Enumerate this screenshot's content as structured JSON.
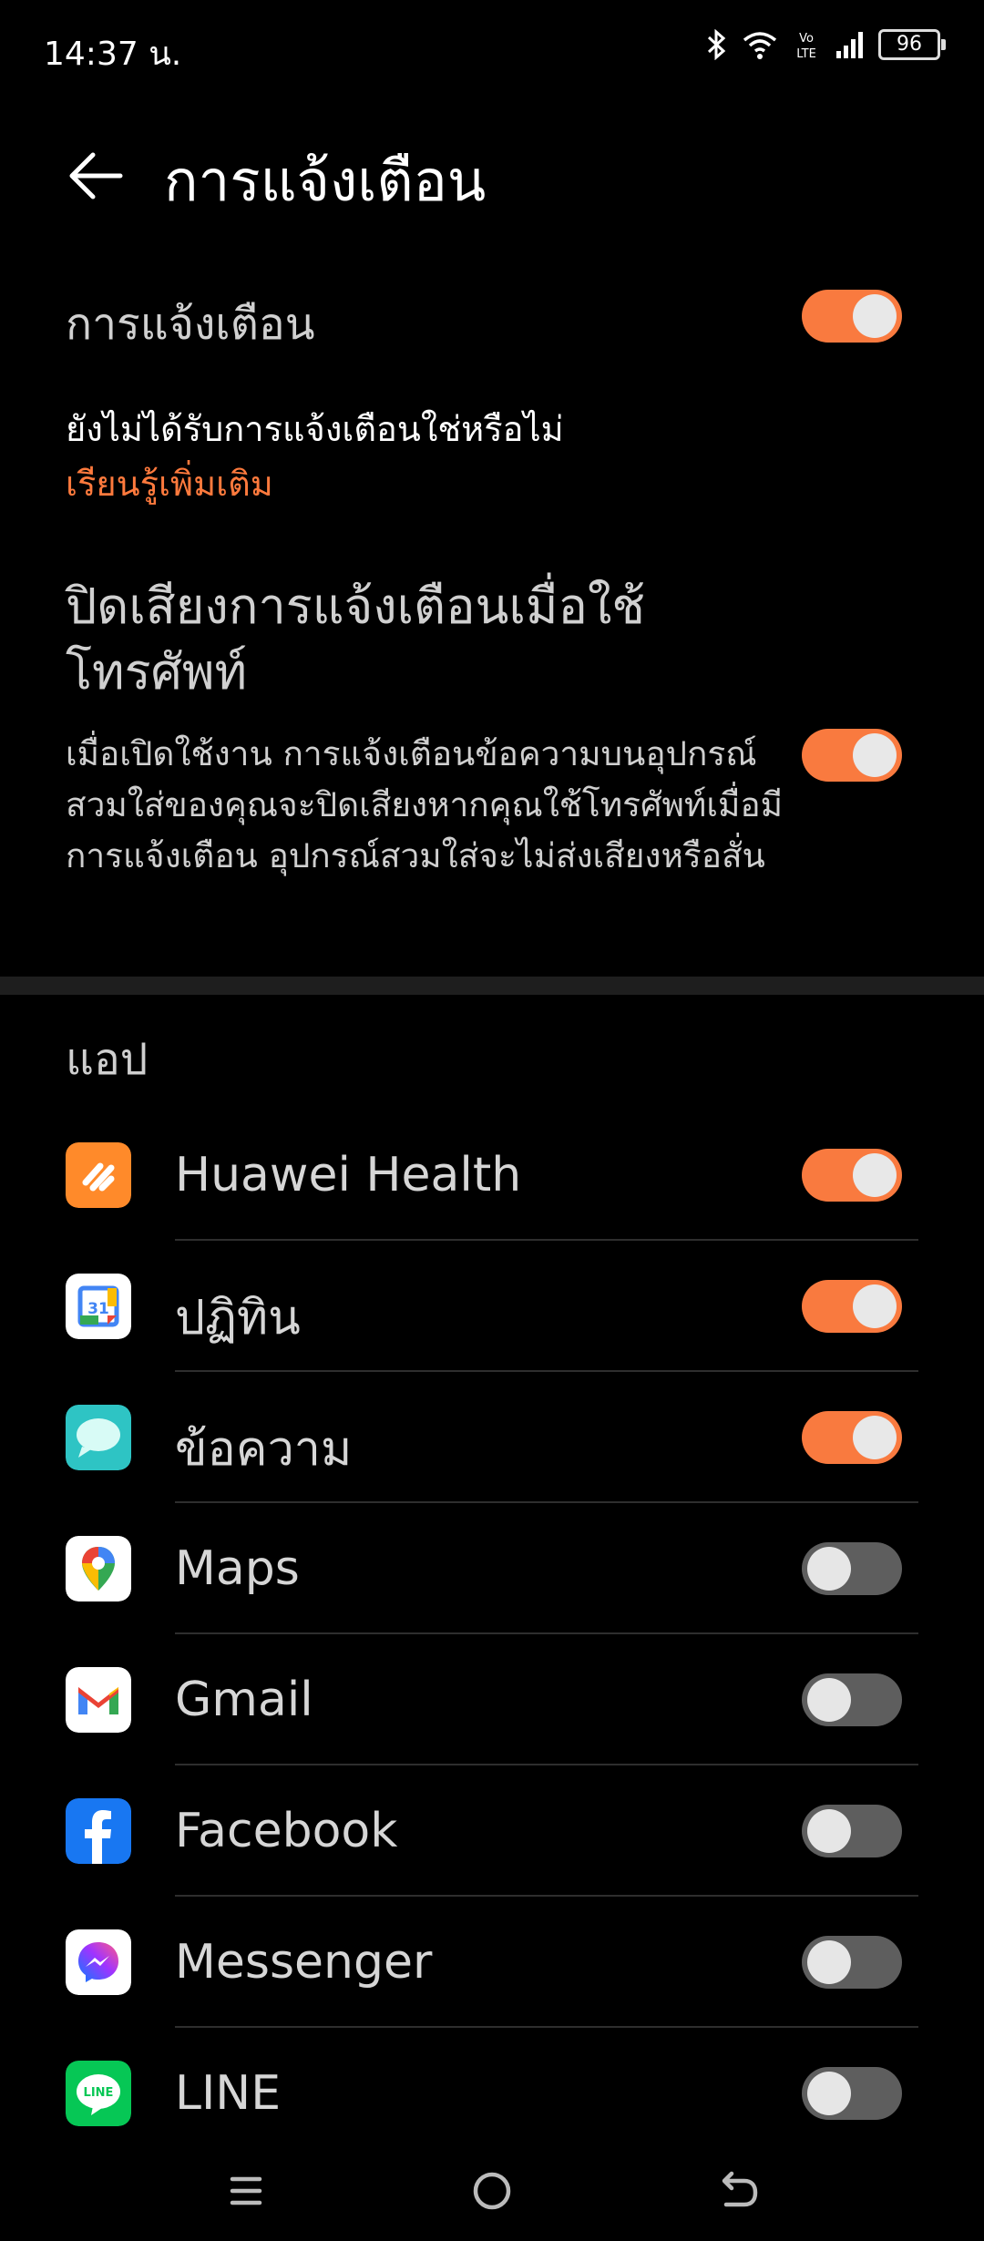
{
  "status": {
    "time": "14:37 น.",
    "battery": "96",
    "network": "Vo LTE"
  },
  "header": {
    "title": "การแจ้งเตือน"
  },
  "notifications": {
    "label": "การแจ้งเตือน",
    "enabled": true,
    "info": "ยังไม่ได้รับการแจ้งเตือนใช่หรือไม่",
    "learn_more": "เรียนรู้เพิ่มเติม"
  },
  "mute": {
    "title": "ปิดเสียงการแจ้งเตือนเมื่อใช้โทรศัพท์",
    "description": "เมื่อเปิดใช้งาน การแจ้งเตือนข้อความบนอุปกรณ์สวมใส่ของคุณจะปิดเสียงหากคุณใช้โทรศัพท์เมื่อมีการแจ้งเตือน อุปกรณ์สวมใส่จะไม่ส่งเสียงหรือสั่น",
    "enabled": true
  },
  "apps_section": {
    "label": "แอป"
  },
  "apps": [
    {
      "name": "Huawei Health",
      "icon": "huawei-health-icon",
      "enabled": true
    },
    {
      "name": "ปฏิทิน",
      "icon": "calendar-icon",
      "enabled": true
    },
    {
      "name": "ข้อความ",
      "icon": "messages-icon",
      "enabled": true
    },
    {
      "name": "Maps",
      "icon": "maps-icon",
      "enabled": false
    },
    {
      "name": "Gmail",
      "icon": "gmail-icon",
      "enabled": false
    },
    {
      "name": "Facebook",
      "icon": "facebook-icon",
      "enabled": false
    },
    {
      "name": "Messenger",
      "icon": "messenger-icon",
      "enabled": false
    },
    {
      "name": "LINE",
      "icon": "line-icon",
      "enabled": false
    }
  ],
  "colors": {
    "accent": "#f97a3f",
    "toggle_off": "#5e5e5e",
    "background": "#000000"
  }
}
